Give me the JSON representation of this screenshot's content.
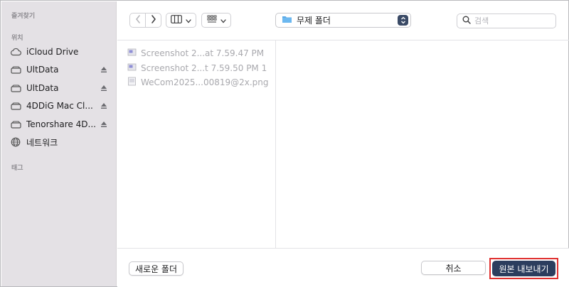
{
  "sidebar": {
    "favorites_header": "즐겨찾기",
    "locations_header": "위치",
    "tags_header": "태그",
    "items": [
      {
        "label": "iCloud Drive",
        "icon": "cloud-icon",
        "eject": false
      },
      {
        "label": "UltData",
        "icon": "drive-icon",
        "eject": true
      },
      {
        "label": "UltData",
        "icon": "drive-icon",
        "eject": true
      },
      {
        "label": "4DDiG Mac Cl...",
        "icon": "drive-icon",
        "eject": true
      },
      {
        "label": "Tenorshare 4D...",
        "icon": "drive-icon",
        "eject": true
      },
      {
        "label": "네트워크",
        "icon": "globe-icon",
        "eject": false
      }
    ]
  },
  "toolbar": {
    "back_icon": "chevron-left-icon",
    "forward_icon": "chevron-right-icon",
    "column_view_icon": "column-view-icon",
    "grid_view_icon": "grid-view-icon",
    "current_folder": "무제 폴더",
    "search_placeholder": "검색"
  },
  "files": [
    {
      "name": "Screenshot 2...at 7.59.47 PM",
      "icon": "screenshot-file-icon"
    },
    {
      "name": "Screenshot 2...t 7.59.50 PM 1",
      "icon": "screenshot-file-icon"
    },
    {
      "name": "WeCom2025...00819@2x.png",
      "icon": "png-file-icon"
    }
  ],
  "buttons": {
    "new_folder": "새로운 폴더",
    "cancel": "취소",
    "export": "원본 내보내기"
  },
  "colors": {
    "sidebar_bg": "#e4e1e5",
    "primary_button": "#2c3e5e",
    "highlight_outline": "#e0302f"
  }
}
